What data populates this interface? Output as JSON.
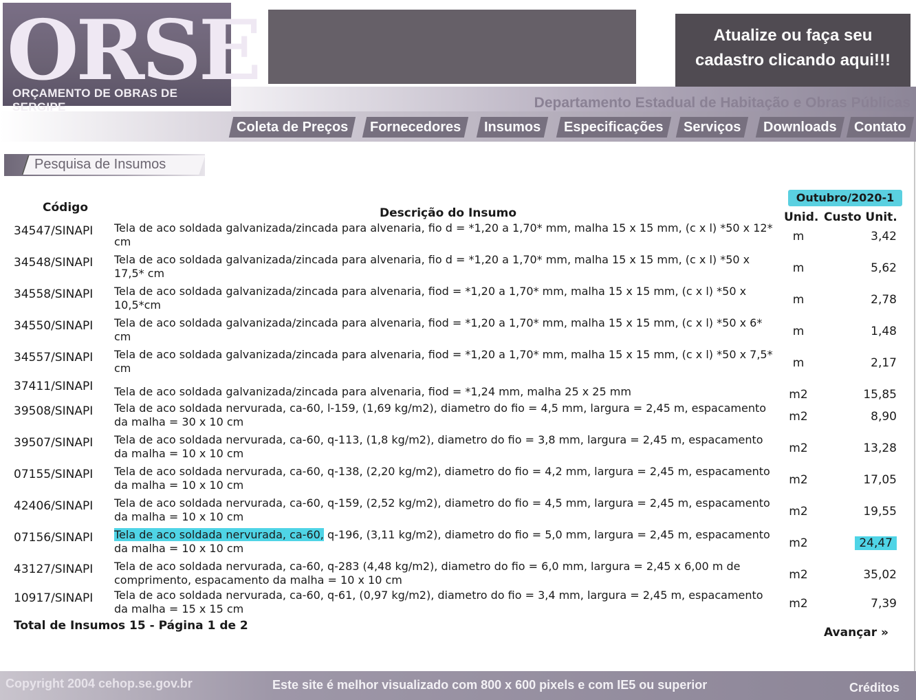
{
  "header": {
    "logo_text": "ORSE",
    "logo_subtitle": "ORÇAMENTO DE OBRAS DE SERGIPE",
    "cadastro_line1": "Atualize ou faça seu",
    "cadastro_line2": "cadastro clicando aqui!!!",
    "department": "Departamento Estadual de Habitação e Obras Públicas"
  },
  "nav": {
    "items": [
      {
        "label": "Coleta de Preços"
      },
      {
        "label": "Fornecedores"
      },
      {
        "label": "Insumos"
      },
      {
        "label": "Especificações"
      },
      {
        "label": "Serviços"
      },
      {
        "label": "Downloads"
      },
      {
        "label": "Contato"
      }
    ]
  },
  "page": {
    "title": "Pesquisa de Insumos"
  },
  "table": {
    "period": "Outubro/2020-1",
    "col_code": "Código",
    "col_desc": "Descrição do Insumo",
    "col_unit": "Unid.",
    "col_cost": "Custo Unit.",
    "rows": [
      {
        "code": "34547/SINAPI",
        "desc": "Tela de aco soldada galvanizada/zincada para alvenaria, fio d = *1,20 a 1,70* mm, malha 15 x 15 mm, (c x l) *50 x 12* cm",
        "unit": "m",
        "cost": "3,42"
      },
      {
        "code": "34548/SINAPI",
        "desc": "Tela de aco soldada galvanizada/zincada para alvenaria, fio d = *1,20 a 1,70* mm, malha 15 x 15 mm, (c x l) *50 x 17,5* cm",
        "unit": "m",
        "cost": "5,62"
      },
      {
        "code": "34558/SINAPI",
        "desc": "Tela de aco soldada galvanizada/zincada para alvenaria, fiod = *1,20 a 1,70* mm, malha 15 x 15 mm, (c x l) *50 x 10,5*cm",
        "unit": "m",
        "cost": "2,78"
      },
      {
        "code": "34550/SINAPI",
        "desc": "Tela de aco soldada galvanizada/zincada para alvenaria, fiod = *1,20 a 1,70* mm, malha 15 x 15 mm, (c x l) *50 x 6* cm",
        "unit": "m",
        "cost": "1,48"
      },
      {
        "code": "34557/SINAPI",
        "desc": "Tela de aco soldada galvanizada/zincada para alvenaria, fiod = *1,20 a 1,70* mm, malha 15 x 15 mm, (c x l) *50 x 7,5* cm",
        "unit": "m",
        "cost": "2,17"
      },
      {
        "code": "37411/SINAPI",
        "desc": "Tela de aco soldada galvanizada/zincada para alvenaria, fiod = *1,24 mm, malha 25 x 25 mm",
        "unit": "m2",
        "cost": "15,85"
      },
      {
        "code": "39508/SINAPI",
        "desc": "Tela de aco soldada nervurada, ca-60, l-159, (1,69 kg/m2), diametro do fio = 4,5 mm, largura = 2,45 m, espacamento da malha = 30 x 10 cm",
        "unit": "m2",
        "cost": "8,90"
      },
      {
        "code": "39507/SINAPI",
        "desc": "Tela de aco soldada nervurada, ca-60, q-113, (1,8 kg/m2), diametro do fio = 3,8 mm, largura = 2,45 m, espacamento da malha = 10 x 10 cm",
        "unit": "m2",
        "cost": "13,28"
      },
      {
        "code": "07155/SINAPI",
        "desc": "Tela de aco soldada nervurada, ca-60, q-138, (2,20 kg/m2), diametro do fio = 4,2 mm, largura = 2,45 m, espacamento da malha = 10 x 10 cm",
        "unit": "m2",
        "cost": "17,05"
      },
      {
        "code": "42406/SINAPI",
        "desc": "Tela de aco soldada nervurada, ca-60, q-159, (2,52 kg/m2), diametro do fio = 4,5 mm, largura = 2,45 m, espacamento da malha = 10 x 10 cm",
        "unit": "m2",
        "cost": "19,55"
      },
      {
        "code": "07156/SINAPI",
        "desc_hl": "Tela de aco soldada nervurada, ca-60,",
        "desc_rest": " q-196, (3,11 kg/m2), diametro do fio = 5,0 mm, largura = 2,45 m, espacamento da malha = 10 x 10 cm",
        "unit": "m2",
        "cost": "24,47"
      },
      {
        "code": "43127/SINAPI",
        "desc": "Tela de aco soldada nervurada, ca-60, q-283 (4,48 kg/m2), diametro do fio = 6,0 mm, largura = 2,45 x 6,00 m de comprimento, espacamento da malha = 10 x 10 cm",
        "unit": "m2",
        "cost": "35,02"
      },
      {
        "code": "10917/SINAPI",
        "desc": "Tela de aco soldada nervurada, ca-60, q-61, (0,97 kg/m2), diametro do fio = 3,4 mm, largura = 2,45 m, espacamento da malha = 15 x 15 cm",
        "unit": "m2",
        "cost": "7,39"
      }
    ],
    "total": "Total de Insumos 15 - Página 1 de 2",
    "next": "Avançar »"
  },
  "footer": {
    "copyright": "Copyright 2004 cehop.se.gov.br",
    "best_view": "Este site é melhor visualizado com 800 x 600 pixels e com IE5 ou superior",
    "credits": "Créditos"
  },
  "colors": {
    "highlight": "#4fd4e6",
    "nav_bg": "#77707f"
  }
}
